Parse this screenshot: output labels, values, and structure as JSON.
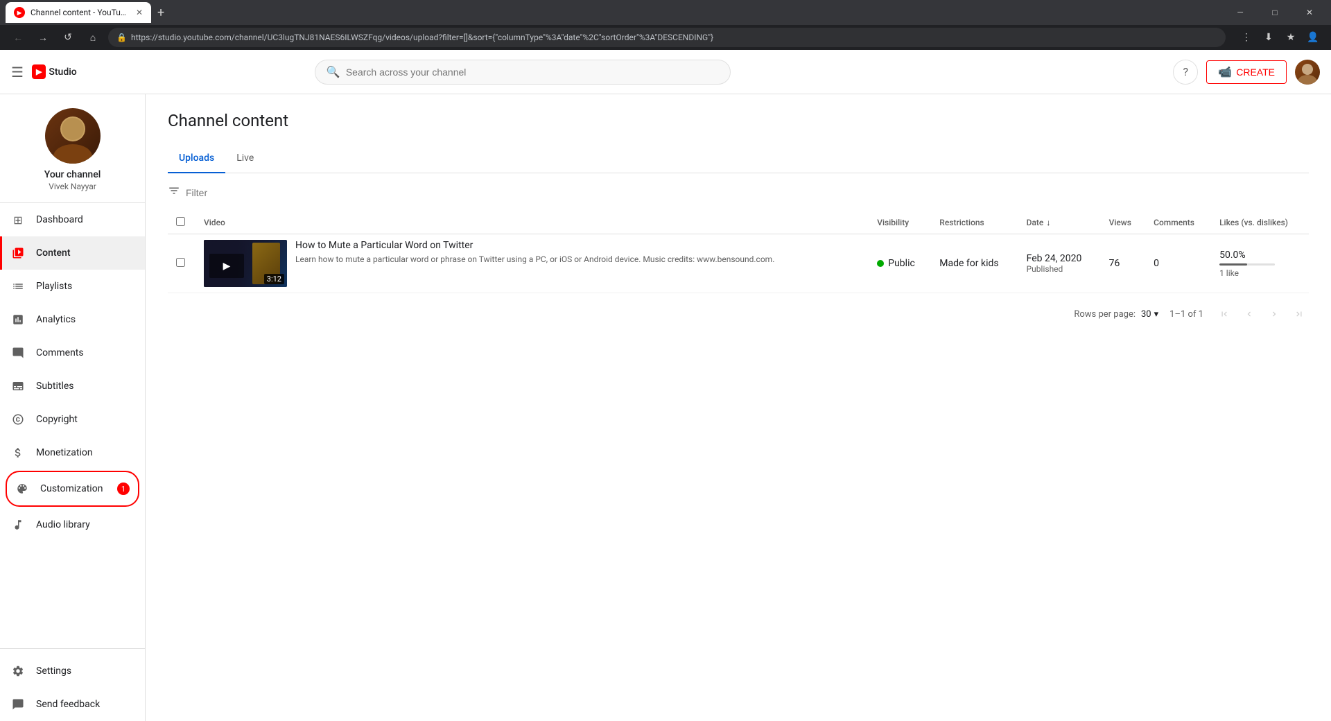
{
  "browser": {
    "tab_title": "Channel content - YouTube St...",
    "url": "https://studio.youtube.com/channel/UC3lugTNJ81NAES6ILWSZFqg/videos/upload?filter=[]&sort={\"columnType\"%3A\"date\"%2C\"sortOrder\"%3A\"DESCENDING\"}",
    "new_tab_label": "+",
    "window_controls": {
      "minimize": "—",
      "maximize": "□",
      "close": "✕"
    },
    "nav_back": "←",
    "nav_forward": "→",
    "nav_refresh": "↺"
  },
  "topbar": {
    "menu_icon": "☰",
    "logo_icon": "▶",
    "logo_text": "Studio",
    "search_placeholder": "Search across your channel",
    "help_icon": "?",
    "create_label": "CREATE",
    "create_icon": "📹"
  },
  "sidebar": {
    "channel_name": "Your channel",
    "channel_username": "Vivek Nayyar",
    "nav_items": [
      {
        "id": "dashboard",
        "label": "Dashboard",
        "icon": "⊞",
        "active": false
      },
      {
        "id": "content",
        "label": "Content",
        "icon": "▶",
        "active": true
      },
      {
        "id": "playlists",
        "label": "Playlists",
        "icon": "☰",
        "active": false
      },
      {
        "id": "analytics",
        "label": "Analytics",
        "icon": "📊",
        "active": false
      },
      {
        "id": "comments",
        "label": "Comments",
        "icon": "💬",
        "active": false
      },
      {
        "id": "subtitles",
        "label": "Subtitles",
        "icon": "CC",
        "active": false
      },
      {
        "id": "copyright",
        "label": "Copyright",
        "icon": "©",
        "active": false
      },
      {
        "id": "monetization",
        "label": "Monetization",
        "icon": "$",
        "active": false
      },
      {
        "id": "customization",
        "label": "Customization",
        "icon": "✨",
        "active": false,
        "badge": "1"
      },
      {
        "id": "audio",
        "label": "Audio library",
        "icon": "🎵",
        "active": false
      }
    ],
    "bottom_items": [
      {
        "id": "settings",
        "label": "Settings",
        "icon": "⚙"
      },
      {
        "id": "feedback",
        "label": "Send feedback",
        "icon": "⚑"
      }
    ]
  },
  "page": {
    "title": "Channel content",
    "tabs": [
      {
        "id": "uploads",
        "label": "Uploads",
        "active": true
      },
      {
        "id": "live",
        "label": "Live",
        "active": false
      }
    ],
    "filter_placeholder": "Filter"
  },
  "table": {
    "columns": {
      "video": "Video",
      "visibility": "Visibility",
      "restrictions": "Restrictions",
      "date": "Date",
      "views": "Views",
      "comments": "Comments",
      "likes": "Likes (vs. dislikes)"
    },
    "rows": [
      {
        "id": "row1",
        "title": "How to Mute a Particular Word on Twitter",
        "description": "Learn how to mute a particular word or phrase on Twitter using a PC, or iOS or Android device. Music credits: www.bensound.com.",
        "duration": "3:12",
        "visibility": "Public",
        "visibility_color": "#00aa00",
        "restrictions": "Made for kids",
        "date": "Feb 24, 2020",
        "date_status": "Published",
        "views": "76",
        "comments": "0",
        "likes_pct": "50.0%",
        "likes_sub": "1 like",
        "likes_bar_pct": 50
      }
    ]
  },
  "pagination": {
    "rows_per_page_label": "Rows per page:",
    "rows_per_page_value": "30",
    "page_info": "1–1 of 1",
    "first_icon": "|◀",
    "prev_icon": "◀",
    "next_icon": "▶",
    "last_icon": "▶|"
  }
}
